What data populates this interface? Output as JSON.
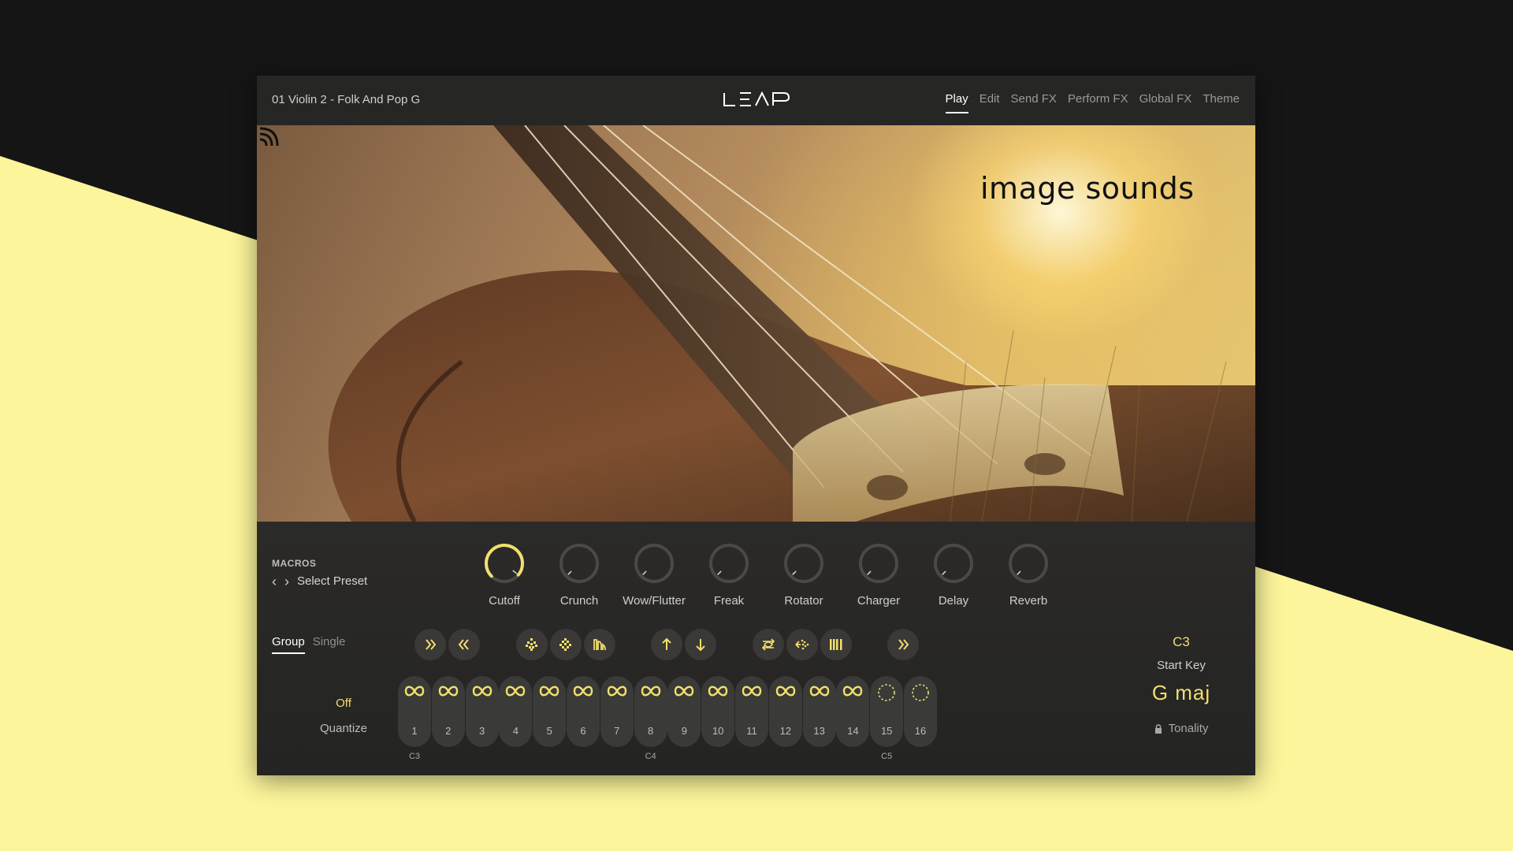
{
  "header": {
    "preset_name": "01 Violin 2 - Folk And Pop G",
    "logo_text": "LEAP",
    "nav": [
      {
        "label": "Play",
        "active": true
      },
      {
        "label": "Edit"
      },
      {
        "label": "Send FX"
      },
      {
        "label": "Perform FX"
      },
      {
        "label": "Global FX"
      },
      {
        "label": "Theme"
      }
    ]
  },
  "hero": {
    "brand": "image sounds",
    "brand_icon": "sound-waves-icon"
  },
  "macros": {
    "title": "MACROS",
    "select_preset": "Select Preset",
    "prev_icon": "chevron-left-icon",
    "next_icon": "chevron-right-icon",
    "knobs": [
      {
        "label": "Cutoff",
        "value": 0.98
      },
      {
        "label": "Crunch",
        "value": 0
      },
      {
        "label": "Wow/Flutter",
        "value": 0
      },
      {
        "label": "Freak",
        "value": 0
      },
      {
        "label": "Rotator",
        "value": 0
      },
      {
        "label": "Charger",
        "value": 0
      },
      {
        "label": "Delay",
        "value": 0
      },
      {
        "label": "Reverb",
        "value": 0
      }
    ]
  },
  "mode_tabs": [
    {
      "label": "Group",
      "active": true
    },
    {
      "label": "Single"
    }
  ],
  "quantize": {
    "value": "Off",
    "label": "Quantize"
  },
  "perform_buttons": [
    "fast-forward-icon",
    "rewind-icon",
    "stutter-icon",
    "stutter-alt-icon",
    "filter-envelope-icon",
    "pitch-up-icon",
    "pitch-down-icon",
    "swap-icon",
    "reverse-icon",
    "gate-icon",
    "fast-forward-icon"
  ],
  "pads": [
    {
      "number": "1",
      "state": "loop"
    },
    {
      "number": "2",
      "state": "loop"
    },
    {
      "number": "3",
      "state": "loop"
    },
    {
      "number": "4",
      "state": "loop"
    },
    {
      "number": "5",
      "state": "loop"
    },
    {
      "number": "6",
      "state": "loop"
    },
    {
      "number": "7",
      "state": "loop"
    },
    {
      "number": "8",
      "state": "loop"
    },
    {
      "number": "9",
      "state": "loop"
    },
    {
      "number": "10",
      "state": "loop"
    },
    {
      "number": "11",
      "state": "loop"
    },
    {
      "number": "12",
      "state": "loop"
    },
    {
      "number": "13",
      "state": "loop"
    },
    {
      "number": "14",
      "state": "loop"
    },
    {
      "number": "15",
      "state": "one-shot"
    },
    {
      "number": "16",
      "state": "one-shot"
    }
  ],
  "note_labels": [
    {
      "pad": 1,
      "label": "C3"
    },
    {
      "pad": 8,
      "label": "C4"
    },
    {
      "pad": 15,
      "label": "C5"
    }
  ],
  "start_key": {
    "value": "C3",
    "label": "Start Key"
  },
  "tonality": {
    "value": "G  maj",
    "label": "Tonality",
    "icon": "lock-icon"
  },
  "colors": {
    "accent": "#f2df6e",
    "panel": "#242423",
    "background_yellow": "#fcf59b",
    "background_black": "#151515"
  }
}
